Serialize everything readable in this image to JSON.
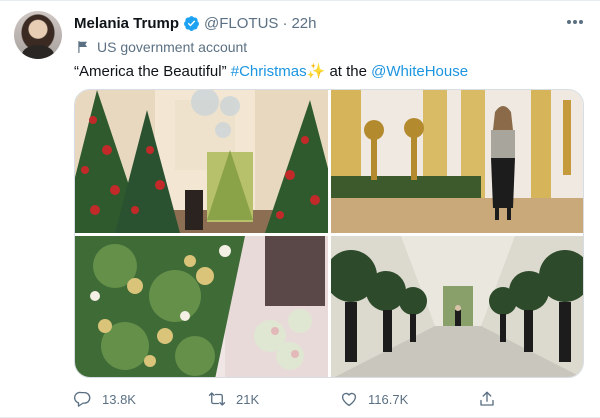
{
  "colors": {
    "link": "#1b95e0",
    "secondary_text": "#5b7083",
    "verified": "#1da1f2",
    "border": "#e6ecf0"
  },
  "author": {
    "display_name": "Melania Trump",
    "handle": "@FLOTUS",
    "separator": "·",
    "time": "22h",
    "verified_icon": "verified-badge-icon",
    "label_icon": "flag-icon",
    "label": "US government account"
  },
  "tweet": {
    "quote_text": "“America the Beautiful” ",
    "hashtag": "#Christmas",
    "emoji": "✨",
    "at_text": " at the ",
    "mention": "@WhiteHouse"
  },
  "media": {
    "photos": [
      {
        "icon": "christmas-trees-grand-hall-photo"
      },
      {
        "icon": "woman-in-east-room-photo"
      },
      {
        "icon": "ornament-tree-closeup-photo"
      },
      {
        "icon": "topiary-corridor-photo"
      }
    ]
  },
  "actions": {
    "reply": {
      "icon": "reply-icon",
      "count": "13.8K"
    },
    "retweet": {
      "icon": "retweet-icon",
      "count": "21K"
    },
    "like": {
      "icon": "heart-icon",
      "count": "116.7K"
    },
    "share": {
      "icon": "share-icon"
    }
  },
  "more_icon": "more-options-icon"
}
